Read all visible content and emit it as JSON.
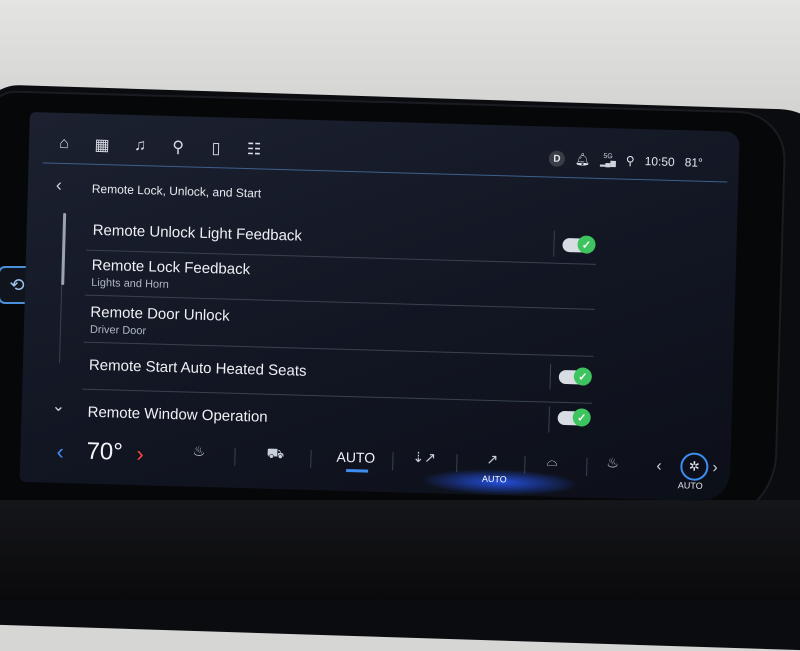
{
  "nav": {
    "items": [
      {
        "name": "home-icon",
        "glyph": "⌂"
      },
      {
        "name": "apps-grid-icon",
        "glyph": "▦"
      },
      {
        "name": "music-note-icon",
        "glyph": "♫"
      },
      {
        "name": "map-pin-icon",
        "glyph": "⚲"
      },
      {
        "name": "phone-icon",
        "glyph": "▯"
      },
      {
        "name": "settings-toggles-icon",
        "glyph": "☷"
      }
    ]
  },
  "status": {
    "drive_mode": "D",
    "signal_label": "5G",
    "time": "10:50",
    "outside_temp": "81°"
  },
  "header": {
    "back_glyph": "‹",
    "title": "Remote Lock, Unlock, and Start"
  },
  "settings": [
    {
      "label": "Remote Unlock Light Feedback",
      "sub": "",
      "toggle": true,
      "enabled": true
    },
    {
      "label": "Remote Lock Feedback",
      "sub": "Lights and Horn",
      "toggle": false
    },
    {
      "label": "Remote Door Unlock",
      "sub": "Driver Door",
      "toggle": false
    },
    {
      "label": "Remote Start Auto Heated Seats",
      "sub": "",
      "toggle": true,
      "enabled": true
    },
    {
      "label": "Remote Window Operation",
      "sub": "",
      "toggle": true,
      "enabled": true
    }
  ],
  "climate": {
    "temperature": "70°",
    "auto_label": "AUTO",
    "airflow_auto_label": "AUTO",
    "fan_auto_label": "AUTO"
  },
  "colors": {
    "accent_blue": "#3d8df0",
    "temp_hot": "#ff4a3a",
    "toggle_on": "#3ec45e"
  }
}
